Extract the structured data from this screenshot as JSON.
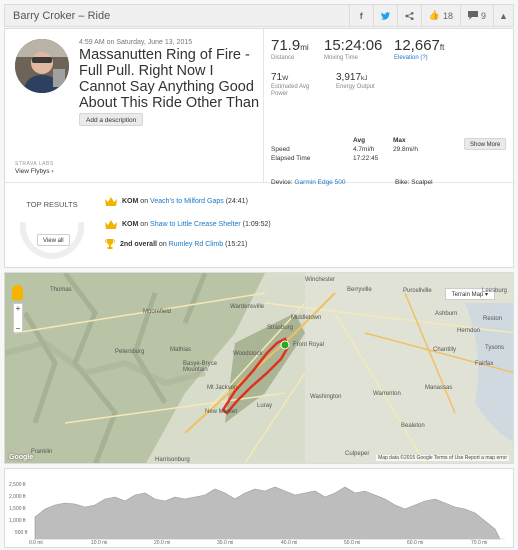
{
  "header": {
    "title": "Barry Croker – Ride",
    "kudos_count": "18",
    "comment_count": "9"
  },
  "activity": {
    "date": "4:59 AM on Saturday, June 13, 2015",
    "title": "Massanutten Ring of Fire - Full Pull. Right Now I Cannot Say Anything Good About This Ride Other Than It's Over",
    "add_description": "Add a description",
    "strava_labs": "STRAVA LABS",
    "view_flybys": "View Flybys ›"
  },
  "stats": {
    "distance": {
      "value": "71.9",
      "unit": "mi",
      "label": "Distance"
    },
    "moving_time": {
      "value": "15:24:06",
      "label": "Moving Time"
    },
    "elevation": {
      "value": "12,667",
      "unit": "ft",
      "label": "Elevation (?)"
    },
    "power": {
      "value": "71",
      "unit": "W",
      "label": "Estimated Avg Power"
    },
    "energy": {
      "value": "3,917",
      "unit": "kJ",
      "label": "Energy Output"
    }
  },
  "table": {
    "headers": [
      "",
      "Avg",
      "Max"
    ],
    "rows": [
      [
        "Speed",
        "4.7mi/h",
        "29.8mi/h"
      ],
      [
        "Elapsed Time",
        "17:22:45",
        ""
      ]
    ],
    "show_more": "Show More"
  },
  "device": {
    "label": "Device:",
    "value": "Garmin Edge 500"
  },
  "bike": {
    "label": "Bike:",
    "value": "Scalpel"
  },
  "top_results": {
    "title": "TOP RESULTS",
    "view_all": "View all",
    "items": [
      {
        "kind": "KOM",
        "prefix": "on",
        "segment": "Veach's to Milford Gaps",
        "time": "(24:41)"
      },
      {
        "kind": "KOM",
        "prefix": "on",
        "segment": "Shaw to Little Crease Shelter",
        "time": "(1:09:52)"
      },
      {
        "kind": "2nd overall",
        "prefix": "on",
        "segment": "Rumley Rd Climb",
        "time": "(15:21)"
      }
    ]
  },
  "map": {
    "type_label": "Terrain Map ▾",
    "footer": "Map data ©2015 Google  Terms of Use  Report a map error",
    "logo": "Google",
    "places": [
      "Thomas",
      "Moorefield",
      "Wardensville",
      "Winchester",
      "Berryville",
      "Purcellville",
      "Leesburg",
      "Middletown",
      "Strasburg",
      "Front Royal",
      "Woodstock",
      "Petersburg",
      "Mathias",
      "Basye-Bryce Mountain",
      "Mt Jackson",
      "New Market",
      "Luray",
      "Washington",
      "Warrenton",
      "Manassas",
      "Herndon",
      "Reston",
      "Chantilly",
      "Fairfax",
      "Ashburn",
      "Tysons",
      "Bealeton",
      "Culpeper",
      "Harrisonburg",
      "Franklin"
    ]
  },
  "elevation_chart": {
    "y_ticks": [
      "2,500 ft",
      "2,000 ft",
      "1,500 ft",
      "1,000 ft",
      "500 ft"
    ],
    "x_ticks": [
      "0.0 mi",
      "10.0 mi",
      "20.0 mi",
      "30.0 mi",
      "40.0 mi",
      "50.0 mi",
      "60.0 mi",
      "70.0 mi"
    ]
  },
  "colors": {
    "route": "#e03020",
    "link": "#1b79c8",
    "crown": "#f0b400",
    "start": "#22aa22"
  }
}
